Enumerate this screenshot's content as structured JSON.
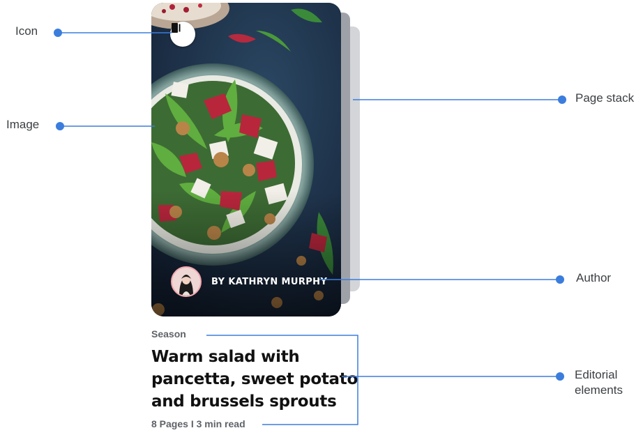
{
  "callouts": {
    "icon": "Icon",
    "image": "Image",
    "page_stack": "Page stack",
    "author": "Author",
    "editorial_line1": "Editorial",
    "editorial_line2": "elements"
  },
  "story": {
    "author": "BY KATHRYN MURPHY",
    "section": "Season",
    "title_line1": "Warm salad with",
    "title_line2": "pancetta, sweet potato",
    "title_line3": "and brussels sprouts",
    "meta": "8 Pages I 3 min read"
  },
  "colors": {
    "callout_line": "#3b7ddd",
    "background_image": "#1d2f45",
    "stack_back": "#d3d5d8",
    "stack_front": "#9ea2a8"
  },
  "icons": {
    "story": "story-stack-icon",
    "author_avatar": "avatar"
  }
}
